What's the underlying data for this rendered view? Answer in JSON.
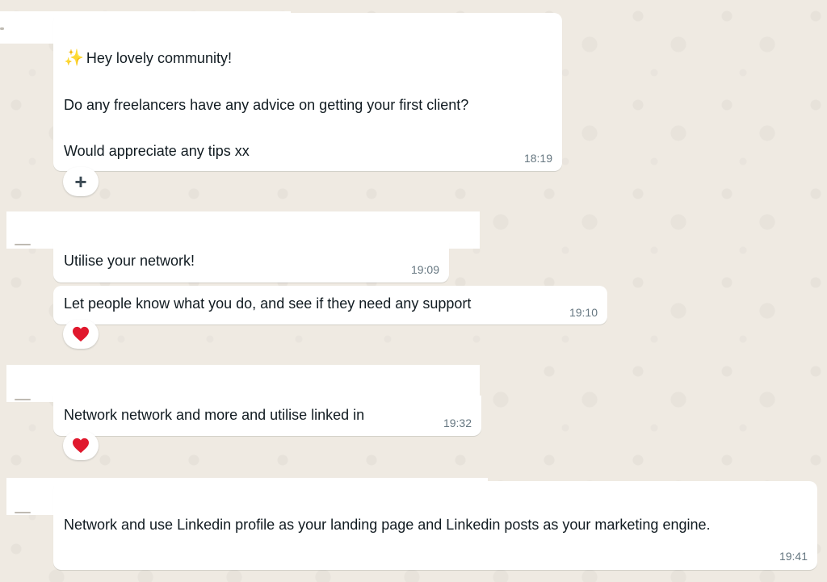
{
  "messages": [
    {
      "lines": [
        "Hey lovely community!",
        "",
        "Do any freelancers have any advice on getting your first client?",
        "",
        "Would appreciate any tips xx"
      ],
      "emoji": "✨",
      "time": "18:19",
      "reaction_icon": "plus-icon",
      "reaction_glyph": "+"
    },
    {
      "text": "Utilise your network!",
      "time": "19:09"
    },
    {
      "text": "Let people know what you do, and see if they need any support",
      "time": "19:10",
      "reaction_icon": "heart-icon"
    },
    {
      "text": "Network network and more and utilise linked in",
      "time": "19:32",
      "reaction_icon": "heart-icon"
    },
    {
      "text": "Network and use Linkedin profile as your landing page and Linkedin posts as your marketing engine.",
      "time": "19:41"
    }
  ],
  "colors": {
    "background": "#efeae2",
    "bubble": "#ffffff",
    "timestamp": "#667781",
    "heart": "#e0182d"
  }
}
